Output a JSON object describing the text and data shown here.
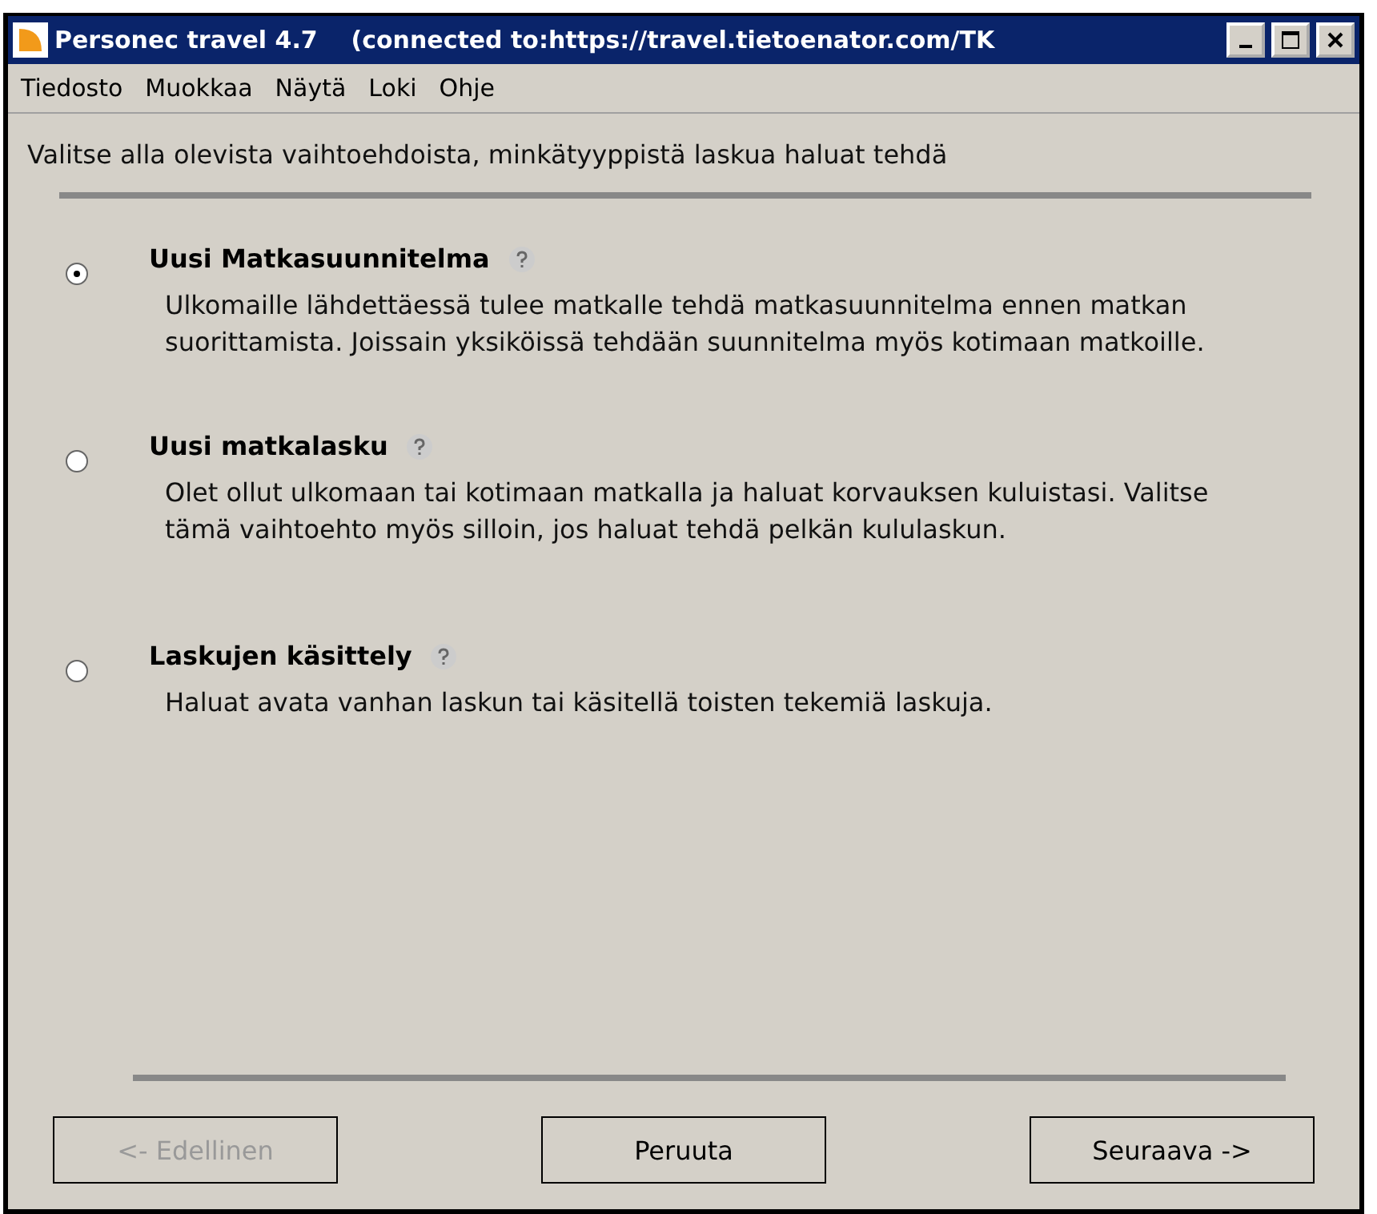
{
  "window": {
    "title": "Personec travel 4.7    (connected to:https://travel.tietoenator.com/TK"
  },
  "menu": [
    "Tiedosto",
    "Muokkaa",
    "Näytä",
    "Loki",
    "Ohje"
  ],
  "instruction": "Valitse alla olevista vaihtoehdoista, minkätyyppistä laskua haluat tehdä",
  "options": [
    {
      "title": "Uusi Matkasuunnitelma",
      "selected": true,
      "description": "Ulkomaille lähdettäessä tulee matkalle tehdä matkasuunnitelma ennen matkan suorittamista. Joissain yksiköissä tehdään suunnitelma myös kotimaan matkoille."
    },
    {
      "title": "Uusi matkalasku",
      "selected": false,
      "description": "Olet ollut ulkomaan tai kotimaan matkalla ja haluat korvauksen kuluistasi. Valitse tämä vaihtoehto myös silloin, jos haluat tehdä pelkän kululaskun."
    },
    {
      "title": "Laskujen käsittely",
      "selected": false,
      "description": "Haluat avata vanhan laskun tai käsitellä toisten tekemiä laskuja."
    }
  ],
  "buttons": [
    {
      "label": "<- Edellinen",
      "disabled": true
    },
    {
      "label": "Peruuta",
      "disabled": false
    },
    {
      "label": "Seuraava ->",
      "disabled": false
    }
  ]
}
